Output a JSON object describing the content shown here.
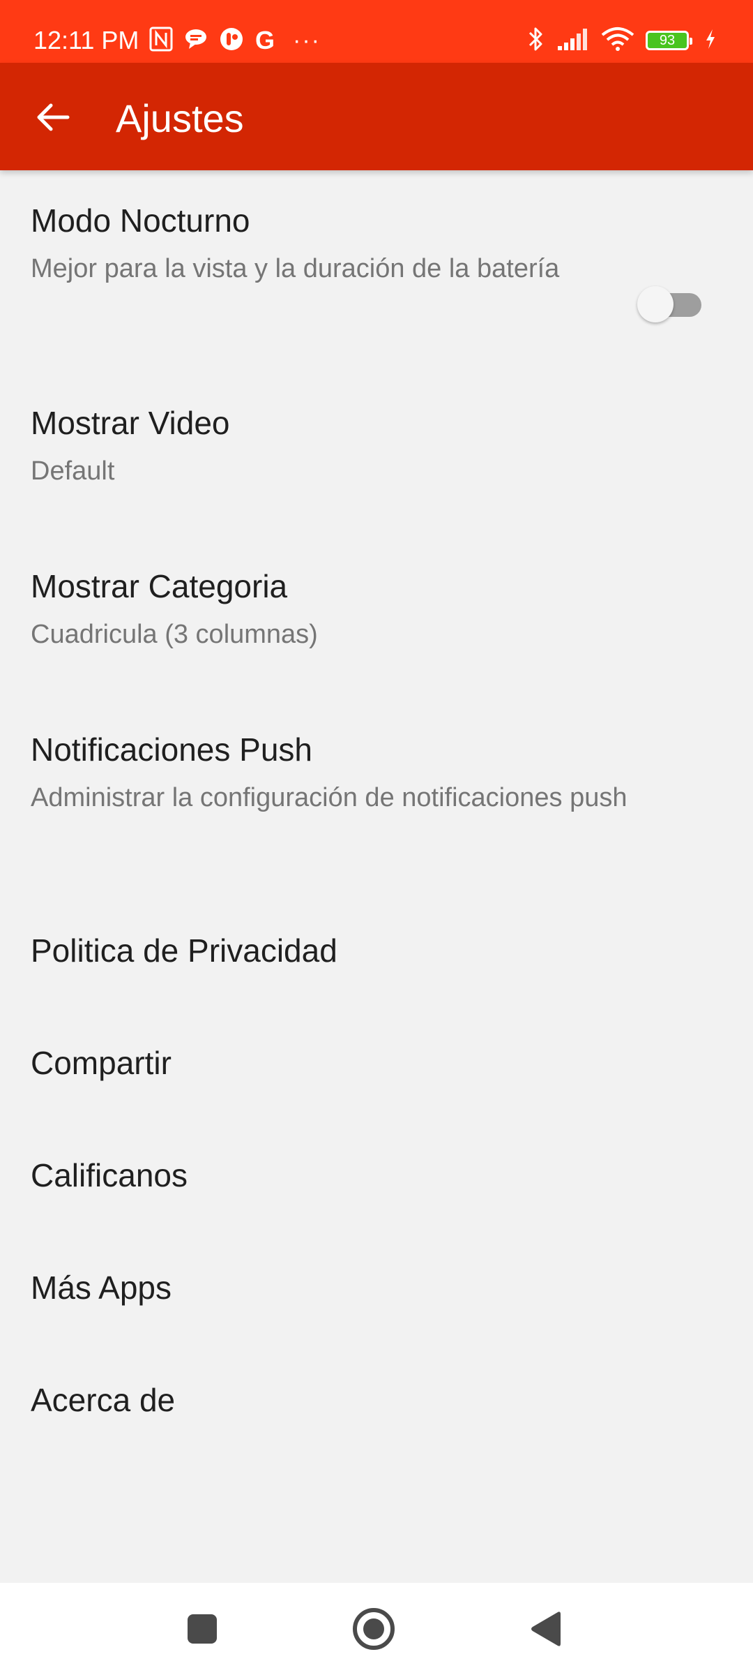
{
  "status_bar": {
    "time": "12:11 PM",
    "left_icons": [
      "nfc-icon",
      "chat-bubble-icon",
      "app-notification-icon",
      "google-icon",
      "more-dots-icon"
    ],
    "right_icons": [
      "bluetooth-icon",
      "signal-icon",
      "wifi-icon",
      "battery-icon",
      "charging-icon"
    ],
    "battery_level": "93",
    "google_glyph": "G",
    "more_glyph": "···"
  },
  "app_bar": {
    "title": "Ajustes",
    "back_icon": "arrow-back-icon",
    "background": "#d32603"
  },
  "settings": {
    "night_mode": {
      "title": "Modo Nocturno",
      "summary": "Mejor para la vista y la duración de la batería",
      "enabled": false
    },
    "show_video": {
      "title": "Mostrar Video",
      "summary": "Default"
    },
    "show_category": {
      "title": "Mostrar Categoria",
      "summary": "Cuadricula (3 columnas)"
    },
    "push_notifications": {
      "title": "Notificaciones Push",
      "summary": "Administrar la configuración de notificaciones push"
    },
    "privacy_policy": {
      "title": "Politica de Privacidad"
    },
    "share": {
      "title": "Compartir"
    },
    "rate_us": {
      "title": "Calificanos"
    },
    "more_apps": {
      "title": "Más Apps"
    },
    "about": {
      "title": "Acerca de"
    }
  },
  "nav_bar": {
    "buttons": [
      "recents-square-icon",
      "home-circle-icon",
      "back-triangle-icon"
    ]
  },
  "colors": {
    "status_bar": "#ff3a14",
    "app_bar": "#d32603",
    "page_background": "#f2f2f2",
    "title_text": "#1f1f1f",
    "summary_text": "#757575",
    "battery_fill": "#49c41f"
  }
}
